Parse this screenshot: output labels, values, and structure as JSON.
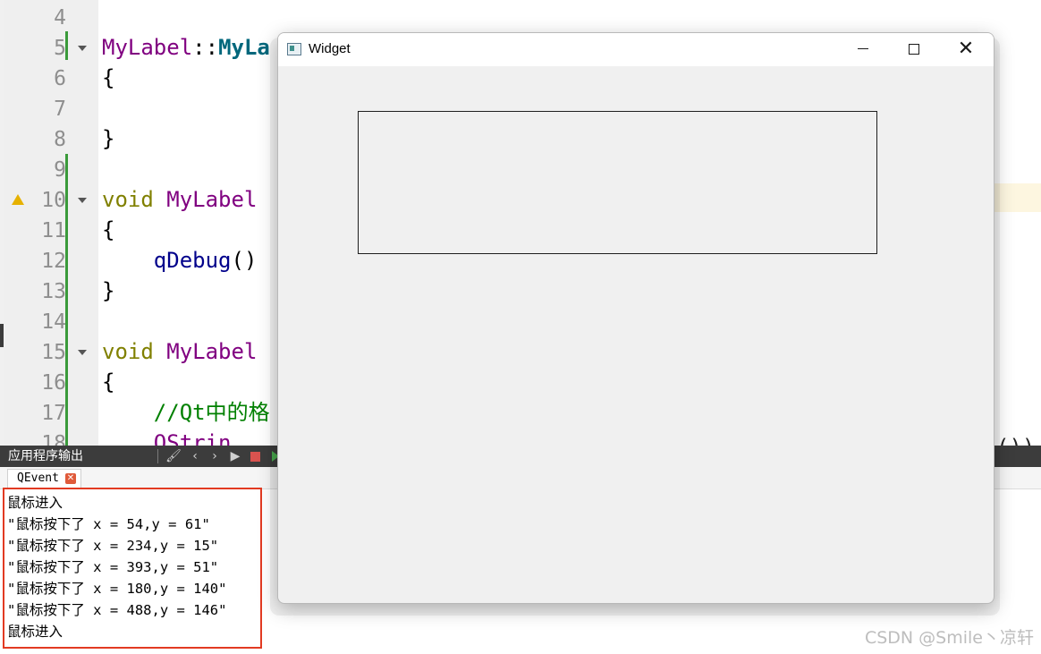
{
  "editor": {
    "lines": [
      {
        "num": "4",
        "tokens": []
      },
      {
        "num": "5",
        "tokens": [
          {
            "text": "MyLabel",
            "cls": "cls"
          },
          {
            "text": "::",
            "cls": ""
          },
          {
            "text": "MyLa",
            "cls": "fn"
          }
        ]
      },
      {
        "num": "6",
        "tokens": [
          {
            "text": "{",
            "cls": ""
          }
        ]
      },
      {
        "num": "7",
        "tokens": []
      },
      {
        "num": "8",
        "tokens": [
          {
            "text": "}",
            "cls": ""
          }
        ]
      },
      {
        "num": "9",
        "tokens": []
      },
      {
        "num": "10",
        "tokens": [
          {
            "text": "void",
            "cls": "kw"
          },
          {
            "text": " ",
            "cls": ""
          },
          {
            "text": "MyLabel",
            "cls": "cls"
          }
        ]
      },
      {
        "num": "11",
        "tokens": [
          {
            "text": "{",
            "cls": ""
          }
        ]
      },
      {
        "num": "12",
        "tokens": [
          {
            "text": "    ",
            "cls": ""
          },
          {
            "text": "qDebug",
            "cls": "call"
          },
          {
            "text": "()",
            "cls": ""
          }
        ]
      },
      {
        "num": "13",
        "tokens": [
          {
            "text": "}",
            "cls": ""
          }
        ]
      },
      {
        "num": "14",
        "tokens": []
      },
      {
        "num": "15",
        "tokens": [
          {
            "text": "void",
            "cls": "kw"
          },
          {
            "text": " ",
            "cls": ""
          },
          {
            "text": "MyLabel",
            "cls": "cls"
          }
        ]
      },
      {
        "num": "16",
        "tokens": [
          {
            "text": "{",
            "cls": ""
          }
        ]
      },
      {
        "num": "17",
        "tokens": [
          {
            "text": "    ",
            "cls": ""
          },
          {
            "text": "//Qt中的格",
            "cls": "cmt"
          }
        ]
      },
      {
        "num": "18",
        "tokens": [
          {
            "text": "    ",
            "cls": ""
          },
          {
            "text": "QStrin",
            "cls": "cls"
          }
        ]
      }
    ],
    "right_fragment": "())"
  },
  "output_pane": {
    "title": "应用程序输出",
    "tab_label": "QEvent",
    "lines": [
      "鼠标进入",
      "\"鼠标按下了 x = 54,y = 61\"",
      "\"鼠标按下了 x = 234,y = 15\"",
      "\"鼠标按下了 x = 393,y = 51\"",
      "\"鼠标按下了 x = 180,y = 140\"",
      "\"鼠标按下了 x = 488,y = 146\"",
      "鼠标进入"
    ]
  },
  "widget_window": {
    "title": "Widget",
    "close_glyph": "✕",
    "minimize_icon": "minimize-icon",
    "maximize_icon": "maximize-icon",
    "close_icon": "close-icon"
  },
  "watermark": "CSDN @Smile丶凉轩",
  "colors": {
    "accent_red": "#e23a22",
    "code_keyword": "#808000",
    "code_class": "#800080",
    "code_comment": "#008000"
  }
}
